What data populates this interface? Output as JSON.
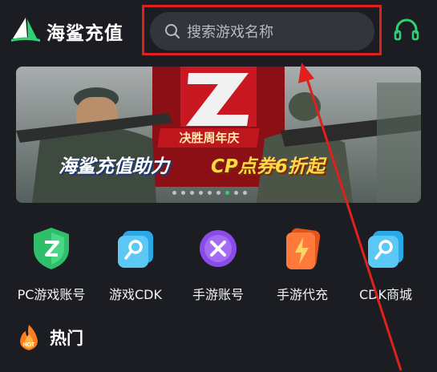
{
  "header": {
    "brand": "海鲨充值",
    "logo_icon": "shark-fin-logo-icon",
    "search_placeholder": "搜索游戏名称",
    "search_icon": "search-icon",
    "service_icon": "headset-icon"
  },
  "banner": {
    "badge": "决胜周年庆",
    "slogan_left": "海鲨充值助力",
    "slogan_right": "CP点券6折起",
    "carousel_index": 6,
    "carousel_count": 9
  },
  "categories": [
    {
      "label": "PC游戏账号",
      "icon": "shield-z-icon"
    },
    {
      "label": "游戏CDK",
      "icon": "key-card-icon"
    },
    {
      "label": "手游账号",
      "icon": "controller-x-icon"
    },
    {
      "label": "手游代充",
      "icon": "lightning-phone-icon"
    },
    {
      "label": "CDK商城",
      "icon": "key-card-icon"
    }
  ],
  "hot": {
    "title": "热门",
    "badge": "HOT",
    "icon": "fire-icon"
  },
  "colors": {
    "background": "#1c1d22",
    "search_bg": "#33353d",
    "accent_green": "#2fd174",
    "annotation_red": "#e0201c"
  }
}
